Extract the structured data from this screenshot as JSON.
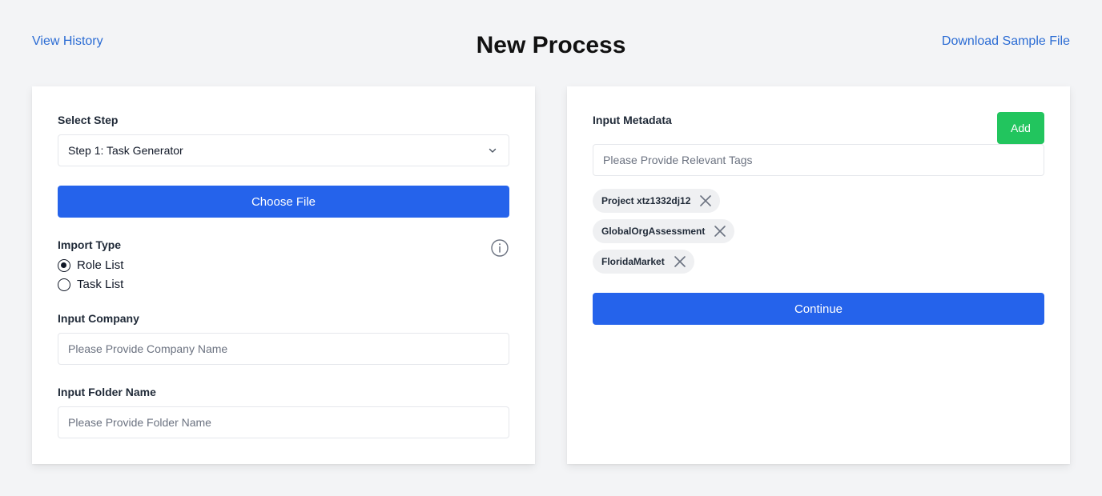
{
  "header": {
    "view_history": "View History",
    "title": "New Process",
    "download_sample": "Download Sample File"
  },
  "left": {
    "select_step_label": "Select Step",
    "select_step_value": "Step 1: Task Generator",
    "choose_file": "Choose File",
    "import_type_label": "Import Type",
    "import_options": [
      {
        "label": "Role List",
        "checked": true
      },
      {
        "label": "Task List",
        "checked": false
      }
    ],
    "company_label": "Input Company",
    "company_placeholder": "Please Provide Company Name",
    "folder_label": "Input Folder Name",
    "folder_placeholder": "Please Provide Folder Name"
  },
  "right": {
    "metadata_label": "Input Metadata",
    "add_button": "Add",
    "tags_placeholder": "Please Provide Relevant Tags",
    "tags": [
      "Project xtz1332dj12",
      "GlobalOrgAssessment",
      "FloridaMarket"
    ],
    "continue_button": "Continue"
  },
  "colors": {
    "primary": "#2563eb",
    "success": "#22c55e",
    "link": "#2b6cd4",
    "background": "#f3f4f6"
  }
}
